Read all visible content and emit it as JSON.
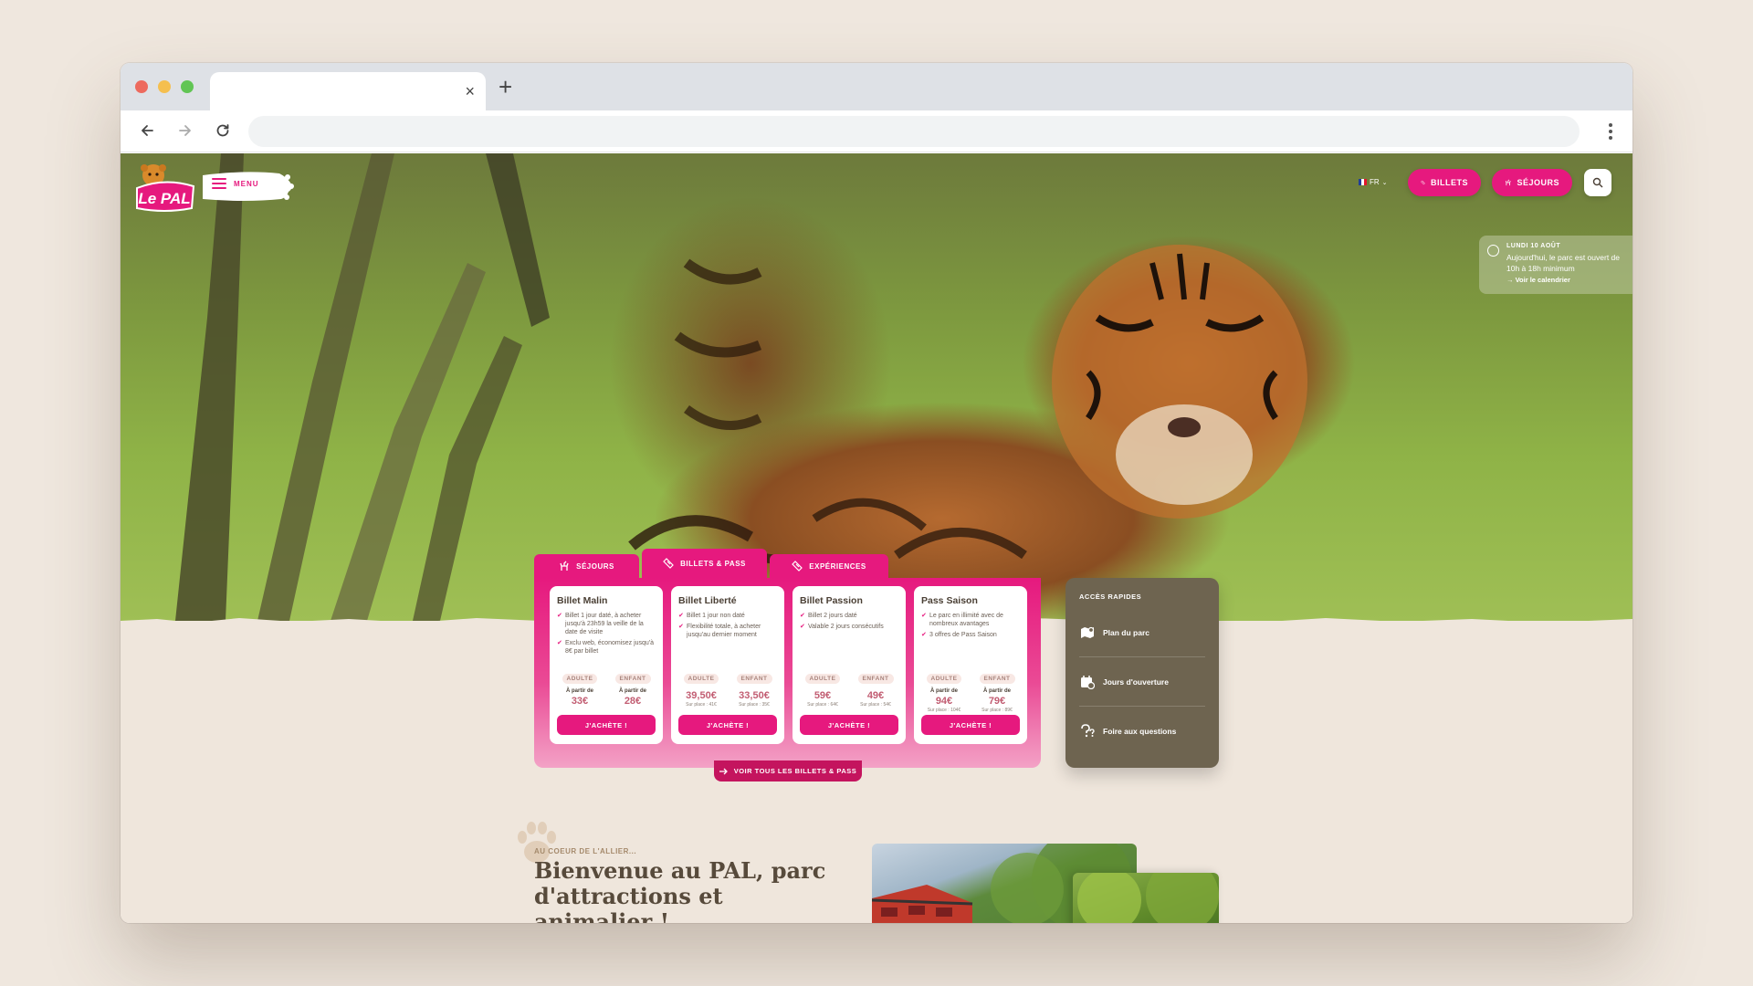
{
  "browser": {
    "tab_close": "×",
    "new_tab": "+"
  },
  "header": {
    "logo_text": "Le PAL",
    "menu_label": "MENU",
    "lang_label": "FR",
    "billets_label": "BILLETS",
    "sejours_label": "SÉJOURS"
  },
  "hours": {
    "date": "LUNDI 10 AOÛT",
    "text": "Aujourd'hui, le parc est ouvert de 10h à 18h minimum",
    "link": "Voir le calendrier"
  },
  "widget": {
    "tabs": [
      {
        "label": "SÉJOURS"
      },
      {
        "label": "BILLETS & PASS"
      },
      {
        "label": "EXPÉRIENCES"
      }
    ],
    "adult_label": "ADULTE",
    "child_label": "ENFANT",
    "from_label": "À partir de",
    "buy_label": "J'ACHÈTE !",
    "see_all": "VOIR TOUS LES BILLETS & PASS",
    "cards": [
      {
        "name": "Billet Malin",
        "features": [
          "Billet 1 jour daté, à acheter jusqu'à 23h59 la veille de la date de visite",
          "Exclu web, économisez jusqu'à 8€ par billet"
        ],
        "adult_price": "33€",
        "child_price": "28€"
      },
      {
        "name": "Billet Liberté",
        "features": [
          "Billet 1 jour non daté",
          "Flexibilité totale, à acheter jusqu'au dernier moment"
        ],
        "adult_price": "39,50€",
        "adult_note": "Sur place : 41€",
        "child_price": "33,50€",
        "child_note": "Sur place : 35€"
      },
      {
        "name": "Billet Passion",
        "features": [
          "Billet 2 jours daté",
          "Valable 2 jours consécutifs"
        ],
        "adult_price": "59€",
        "adult_note": "Sur place : 64€",
        "child_price": "49€",
        "child_note": "Sur place : 54€"
      },
      {
        "name": "Pass Saison",
        "features": [
          "Le parc en illimité avec de nombreux avantages",
          "3 offres de Pass Saison"
        ],
        "adult_price": "94€",
        "adult_note": "Sur place : 104€",
        "child_price": "79€",
        "child_note": "Sur place : 89€"
      }
    ]
  },
  "quick": {
    "title": "ACCÈS RAPIDES",
    "items": [
      {
        "label": "Plan du parc",
        "icon": "map-icon"
      },
      {
        "label": "Jours d'ouverture",
        "icon": "calendar-icon"
      },
      {
        "label": "Foire aux questions",
        "icon": "question-icon"
      }
    ]
  },
  "intro": {
    "kicker": "AU COEUR DE L'ALLIER...",
    "headline": "Bienvenue au PAL, parc d'attractions et animalier !"
  },
  "colors": {
    "brand_pink": "#e6197e",
    "quick_bg": "#6e6450",
    "page_bg": "#efe6dc"
  }
}
